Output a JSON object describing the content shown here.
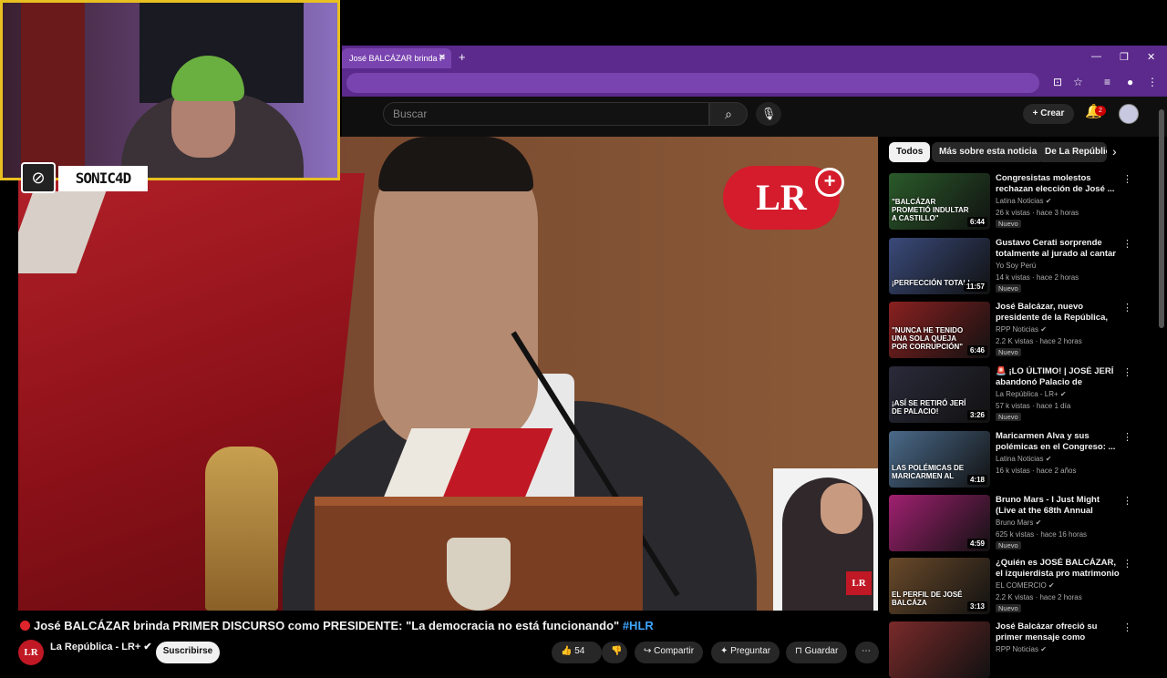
{
  "browser": {
    "tab_title": "José BALCÁZAR brinda P",
    "tab_close": "✕",
    "new_tab": "+",
    "window_controls": [
      "—",
      "❐",
      "✕"
    ]
  },
  "youtube": {
    "search_placeholder": "Buscar",
    "create_label": "Crear",
    "notif_count": "2"
  },
  "overlay": {
    "streamer_name": "SONIC4D",
    "brand_logo": "LR"
  },
  "video": {
    "title": "José BALCÁZAR brinda PRIMER DISCURSO como PRESIDENTE: \"La democracia no está funcionando\"",
    "hashtag": "#HLR",
    "channel": "La República - LR+",
    "subscribe": "Suscribirse",
    "likes": "54",
    "share": "Compartir",
    "ask": "Preguntar",
    "save": "Guardar"
  },
  "sidebar": {
    "chips": [
      "Todos",
      "Más sobre esta noticia",
      "De La Repúblic"
    ],
    "recommendations": [
      {
        "title": "Congresistas molestos rechazan elección de José ...",
        "channel": "Latina Noticias ✔",
        "meta": "26 k vistas · hace 3 horas",
        "badge": "Nuevo",
        "duration": "6:44",
        "caption": "\"Balcázar prometió indultar a Castillo\"",
        "color": "#2a5a2a"
      },
      {
        "title": "Gustavo Cerati sorprende totalmente al jurado al cantar ...",
        "channel": "Yo Soy Perú",
        "meta": "14 k vistas · hace 2 horas",
        "badge": "Nuevo",
        "duration": "11:57",
        "caption": "¡Perfección total!",
        "color": "#3a4a7a"
      },
      {
        "title": "José Balcázar, nuevo presidente de la República, responde a la ...",
        "channel": "RPP Noticias ✔",
        "meta": "2.2 K vistas · hace 2 horas",
        "badge": "Nuevo",
        "duration": "6:46",
        "caption": "\"Nunca he tenido una sola queja por corrupción\"",
        "color": "#8a2020"
      },
      {
        "title": "🚨 ¡LO ÚLTIMO! | JOSÉ JERÍ abandonó Palacio de Gobierno...",
        "channel": "La República - LR+ ✔",
        "meta": "57 k vistas · hace 1 día",
        "badge": "Nuevo",
        "duration": "3:26",
        "caption": "¡Así se retiró Jerí de Palacio!",
        "color": "#2a2a3a"
      },
      {
        "title": "Maricarmen Alva y sus polémicas en el Congreso: ...",
        "channel": "Latina Noticias ✔",
        "meta": "16 k vistas · hace 2 años",
        "badge": "",
        "duration": "4:18",
        "caption": "Las polémicas de Maricarmen Al",
        "color": "#4a6a8a"
      },
      {
        "title": "Bruno Mars - I Just Might (Live at the 68th Annual Grammy ...",
        "channel": "Bruno Mars ✔",
        "meta": "625 k vistas · hace 16 horas",
        "badge": "Nuevo",
        "duration": "4:59",
        "caption": "",
        "color": "#a02070"
      },
      {
        "title": "¿Quién es JOSÉ BALCÁZAR, el izquierdista pro matrimonio ...",
        "channel": "EL COMERCIO ✔",
        "meta": "2.2 K vistas · hace 2 horas",
        "badge": "Nuevo",
        "duration": "3:13",
        "caption": "El perfil de José Balcáza",
        "color": "#6a4a2a"
      },
      {
        "title": "José Balcázar ofreció su primer mensaje como presidente ...",
        "channel": "RPP Noticias ✔",
        "meta": "",
        "badge": "",
        "duration": "",
        "caption": "",
        "color": "#7a2a2a"
      }
    ]
  }
}
